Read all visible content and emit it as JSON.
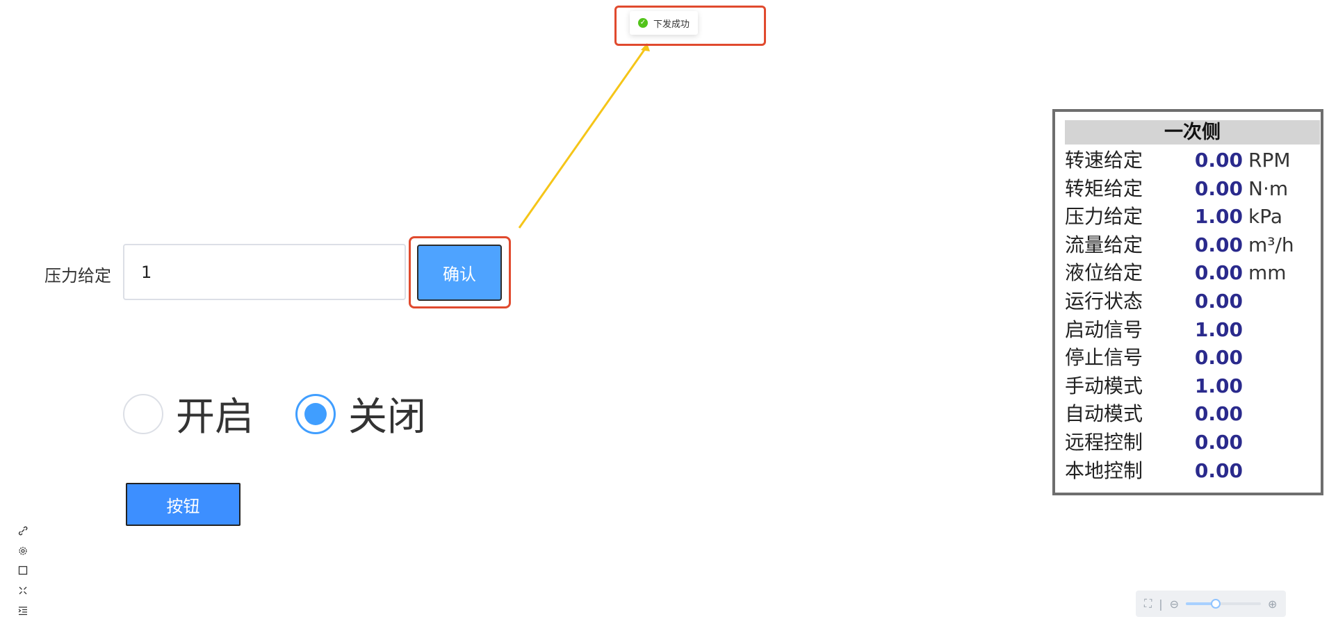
{
  "toast": {
    "message": "下发成功"
  },
  "form": {
    "pressure_label": "压力给定",
    "pressure_value": "1",
    "confirm_label": "确认"
  },
  "radios": [
    {
      "label": "开启",
      "checked": false
    },
    {
      "label": "关闭",
      "checked": true
    }
  ],
  "button_label": "按钮",
  "toolbar": [
    "link-icon",
    "gear-icon",
    "square-icon",
    "collapse-icon",
    "indent-icon"
  ],
  "panel": {
    "title": "一次侧",
    "rows": [
      {
        "name": "转速给定",
        "value": "0.00",
        "unit": "RPM"
      },
      {
        "name": "转矩给定",
        "value": "0.00",
        "unit": "N·m"
      },
      {
        "name": "压力给定",
        "value": "1.00",
        "unit": "kPa"
      },
      {
        "name": "流量给定",
        "value": "0.00",
        "unit": "m³/h"
      },
      {
        "name": "液位给定",
        "value": "0.00",
        "unit": "mm"
      },
      {
        "name": "运行状态",
        "value": "0.00",
        "unit": ""
      },
      {
        "name": "启动信号",
        "value": "1.00",
        "unit": ""
      },
      {
        "name": "停止信号",
        "value": "0.00",
        "unit": ""
      },
      {
        "name": "手动模式",
        "value": "1.00",
        "unit": ""
      },
      {
        "name": "自动模式",
        "value": "0.00",
        "unit": ""
      },
      {
        "name": "远程控制",
        "value": "0.00",
        "unit": ""
      },
      {
        "name": "本地控制",
        "value": "0.00",
        "unit": ""
      }
    ]
  },
  "zoom": {
    "level": 0.4
  },
  "colors": {
    "primary": "#409eff",
    "highlight": "#e04a2e",
    "arrow": "#f5c518",
    "value": "#2a2a8c",
    "success": "#52c41a"
  }
}
